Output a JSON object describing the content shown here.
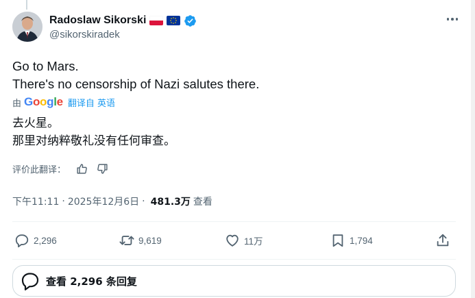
{
  "author": {
    "display_name": "Radoslaw Sikorski",
    "handle": "@sikorskiradek",
    "badges": [
      "poland-flag-icon",
      "eu-flag-icon",
      "verified-badge-icon"
    ]
  },
  "tweet": {
    "text_lines": [
      "Go to Mars.",
      "There's no censorship of Nazi salutes there."
    ]
  },
  "translation": {
    "by_label": "由",
    "provider": "Google",
    "translated_from": "翻译自 英语",
    "text_lines": [
      "去火星。",
      "那里对纳粹敬礼没有任何审查。"
    ],
    "rate_label": "评价此翻译："
  },
  "meta": {
    "time": "下午11:11",
    "separator": "·",
    "date": "2025年12月6日",
    "views_count": "481.3万",
    "views_label": "查看"
  },
  "actions": {
    "replies": "2,296",
    "reposts": "9,619",
    "likes": "11万",
    "bookmarks": "1,794"
  },
  "replies_button": {
    "label": "查看 2,296 条回复"
  },
  "colors": {
    "text_primary": "#0f1419",
    "text_secondary": "#536471",
    "link_blue": "#1d9bf0",
    "border": "#cfd9de",
    "verified_blue": "#1d9bf0"
  }
}
